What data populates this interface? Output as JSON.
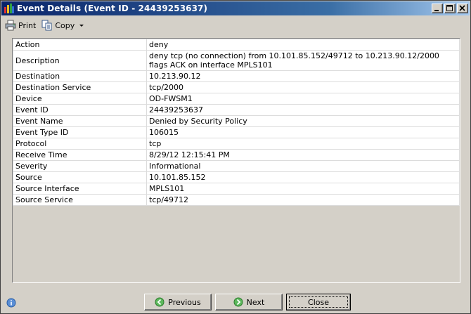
{
  "window": {
    "title": "Event Details (Event ID - 24439253637)",
    "titlebar_color": "#0a246a"
  },
  "toolbar": {
    "print_label": "Print",
    "copy_label": "Copy",
    "print_icon": "printer-icon",
    "copy_icon": "copy-icon"
  },
  "details": [
    {
      "key": "Action",
      "value": "deny"
    },
    {
      "key": "Description",
      "value": "deny tcp (no connection) from 10.101.85.152/49712 to 10.213.90.12/2000 flags ACK  on interface MPLS101"
    },
    {
      "key": "Destination",
      "value": "10.213.90.12"
    },
    {
      "key": "Destination Service",
      "value": "tcp/2000"
    },
    {
      "key": "Device",
      "value": "OD-FWSM1"
    },
    {
      "key": "Event ID",
      "value": "24439253637"
    },
    {
      "key": "Event Name",
      "value": "Denied by Security Policy"
    },
    {
      "key": "Event Type ID",
      "value": "106015"
    },
    {
      "key": "Protocol",
      "value": "tcp"
    },
    {
      "key": "Receive Time",
      "value": "8/29/12 12:15:41 PM"
    },
    {
      "key": "Severity",
      "value": "Informational"
    },
    {
      "key": "Source",
      "value": "10.101.85.152"
    },
    {
      "key": "Source Interface",
      "value": "MPLS101"
    },
    {
      "key": "Source Service",
      "value": "tcp/49712"
    }
  ],
  "buttons": {
    "previous_label": "Previous",
    "next_label": "Next",
    "close_label": "Close"
  }
}
